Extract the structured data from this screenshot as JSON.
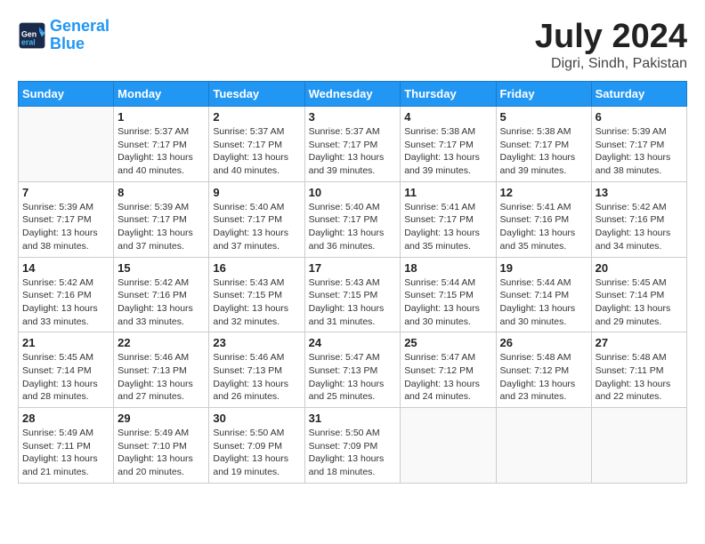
{
  "header": {
    "logo_line1": "General",
    "logo_line2": "Blue",
    "title": "July 2024",
    "subtitle": "Digri, Sindh, Pakistan"
  },
  "weekdays": [
    "Sunday",
    "Monday",
    "Tuesday",
    "Wednesday",
    "Thursday",
    "Friday",
    "Saturday"
  ],
  "weeks": [
    [
      {
        "day": "",
        "sunrise": "",
        "sunset": "",
        "daylight": ""
      },
      {
        "day": "1",
        "sunrise": "Sunrise: 5:37 AM",
        "sunset": "Sunset: 7:17 PM",
        "daylight": "Daylight: 13 hours and 40 minutes."
      },
      {
        "day": "2",
        "sunrise": "Sunrise: 5:37 AM",
        "sunset": "Sunset: 7:17 PM",
        "daylight": "Daylight: 13 hours and 40 minutes."
      },
      {
        "day": "3",
        "sunrise": "Sunrise: 5:37 AM",
        "sunset": "Sunset: 7:17 PM",
        "daylight": "Daylight: 13 hours and 39 minutes."
      },
      {
        "day": "4",
        "sunrise": "Sunrise: 5:38 AM",
        "sunset": "Sunset: 7:17 PM",
        "daylight": "Daylight: 13 hours and 39 minutes."
      },
      {
        "day": "5",
        "sunrise": "Sunrise: 5:38 AM",
        "sunset": "Sunset: 7:17 PM",
        "daylight": "Daylight: 13 hours and 39 minutes."
      },
      {
        "day": "6",
        "sunrise": "Sunrise: 5:39 AM",
        "sunset": "Sunset: 7:17 PM",
        "daylight": "Daylight: 13 hours and 38 minutes."
      }
    ],
    [
      {
        "day": "7",
        "sunrise": "Sunrise: 5:39 AM",
        "sunset": "Sunset: 7:17 PM",
        "daylight": "Daylight: 13 hours and 38 minutes."
      },
      {
        "day": "8",
        "sunrise": "Sunrise: 5:39 AM",
        "sunset": "Sunset: 7:17 PM",
        "daylight": "Daylight: 13 hours and 37 minutes."
      },
      {
        "day": "9",
        "sunrise": "Sunrise: 5:40 AM",
        "sunset": "Sunset: 7:17 PM",
        "daylight": "Daylight: 13 hours and 37 minutes."
      },
      {
        "day": "10",
        "sunrise": "Sunrise: 5:40 AM",
        "sunset": "Sunset: 7:17 PM",
        "daylight": "Daylight: 13 hours and 36 minutes."
      },
      {
        "day": "11",
        "sunrise": "Sunrise: 5:41 AM",
        "sunset": "Sunset: 7:17 PM",
        "daylight": "Daylight: 13 hours and 35 minutes."
      },
      {
        "day": "12",
        "sunrise": "Sunrise: 5:41 AM",
        "sunset": "Sunset: 7:16 PM",
        "daylight": "Daylight: 13 hours and 35 minutes."
      },
      {
        "day": "13",
        "sunrise": "Sunrise: 5:42 AM",
        "sunset": "Sunset: 7:16 PM",
        "daylight": "Daylight: 13 hours and 34 minutes."
      }
    ],
    [
      {
        "day": "14",
        "sunrise": "Sunrise: 5:42 AM",
        "sunset": "Sunset: 7:16 PM",
        "daylight": "Daylight: 13 hours and 33 minutes."
      },
      {
        "day": "15",
        "sunrise": "Sunrise: 5:42 AM",
        "sunset": "Sunset: 7:16 PM",
        "daylight": "Daylight: 13 hours and 33 minutes."
      },
      {
        "day": "16",
        "sunrise": "Sunrise: 5:43 AM",
        "sunset": "Sunset: 7:15 PM",
        "daylight": "Daylight: 13 hours and 32 minutes."
      },
      {
        "day": "17",
        "sunrise": "Sunrise: 5:43 AM",
        "sunset": "Sunset: 7:15 PM",
        "daylight": "Daylight: 13 hours and 31 minutes."
      },
      {
        "day": "18",
        "sunrise": "Sunrise: 5:44 AM",
        "sunset": "Sunset: 7:15 PM",
        "daylight": "Daylight: 13 hours and 30 minutes."
      },
      {
        "day": "19",
        "sunrise": "Sunrise: 5:44 AM",
        "sunset": "Sunset: 7:14 PM",
        "daylight": "Daylight: 13 hours and 30 minutes."
      },
      {
        "day": "20",
        "sunrise": "Sunrise: 5:45 AM",
        "sunset": "Sunset: 7:14 PM",
        "daylight": "Daylight: 13 hours and 29 minutes."
      }
    ],
    [
      {
        "day": "21",
        "sunrise": "Sunrise: 5:45 AM",
        "sunset": "Sunset: 7:14 PM",
        "daylight": "Daylight: 13 hours and 28 minutes."
      },
      {
        "day": "22",
        "sunrise": "Sunrise: 5:46 AM",
        "sunset": "Sunset: 7:13 PM",
        "daylight": "Daylight: 13 hours and 27 minutes."
      },
      {
        "day": "23",
        "sunrise": "Sunrise: 5:46 AM",
        "sunset": "Sunset: 7:13 PM",
        "daylight": "Daylight: 13 hours and 26 minutes."
      },
      {
        "day": "24",
        "sunrise": "Sunrise: 5:47 AM",
        "sunset": "Sunset: 7:13 PM",
        "daylight": "Daylight: 13 hours and 25 minutes."
      },
      {
        "day": "25",
        "sunrise": "Sunrise: 5:47 AM",
        "sunset": "Sunset: 7:12 PM",
        "daylight": "Daylight: 13 hours and 24 minutes."
      },
      {
        "day": "26",
        "sunrise": "Sunrise: 5:48 AM",
        "sunset": "Sunset: 7:12 PM",
        "daylight": "Daylight: 13 hours and 23 minutes."
      },
      {
        "day": "27",
        "sunrise": "Sunrise: 5:48 AM",
        "sunset": "Sunset: 7:11 PM",
        "daylight": "Daylight: 13 hours and 22 minutes."
      }
    ],
    [
      {
        "day": "28",
        "sunrise": "Sunrise: 5:49 AM",
        "sunset": "Sunset: 7:11 PM",
        "daylight": "Daylight: 13 hours and 21 minutes."
      },
      {
        "day": "29",
        "sunrise": "Sunrise: 5:49 AM",
        "sunset": "Sunset: 7:10 PM",
        "daylight": "Daylight: 13 hours and 20 minutes."
      },
      {
        "day": "30",
        "sunrise": "Sunrise: 5:50 AM",
        "sunset": "Sunset: 7:09 PM",
        "daylight": "Daylight: 13 hours and 19 minutes."
      },
      {
        "day": "31",
        "sunrise": "Sunrise: 5:50 AM",
        "sunset": "Sunset: 7:09 PM",
        "daylight": "Daylight: 13 hours and 18 minutes."
      },
      {
        "day": "",
        "sunrise": "",
        "sunset": "",
        "daylight": ""
      },
      {
        "day": "",
        "sunrise": "",
        "sunset": "",
        "daylight": ""
      },
      {
        "day": "",
        "sunrise": "",
        "sunset": "",
        "daylight": ""
      }
    ]
  ]
}
